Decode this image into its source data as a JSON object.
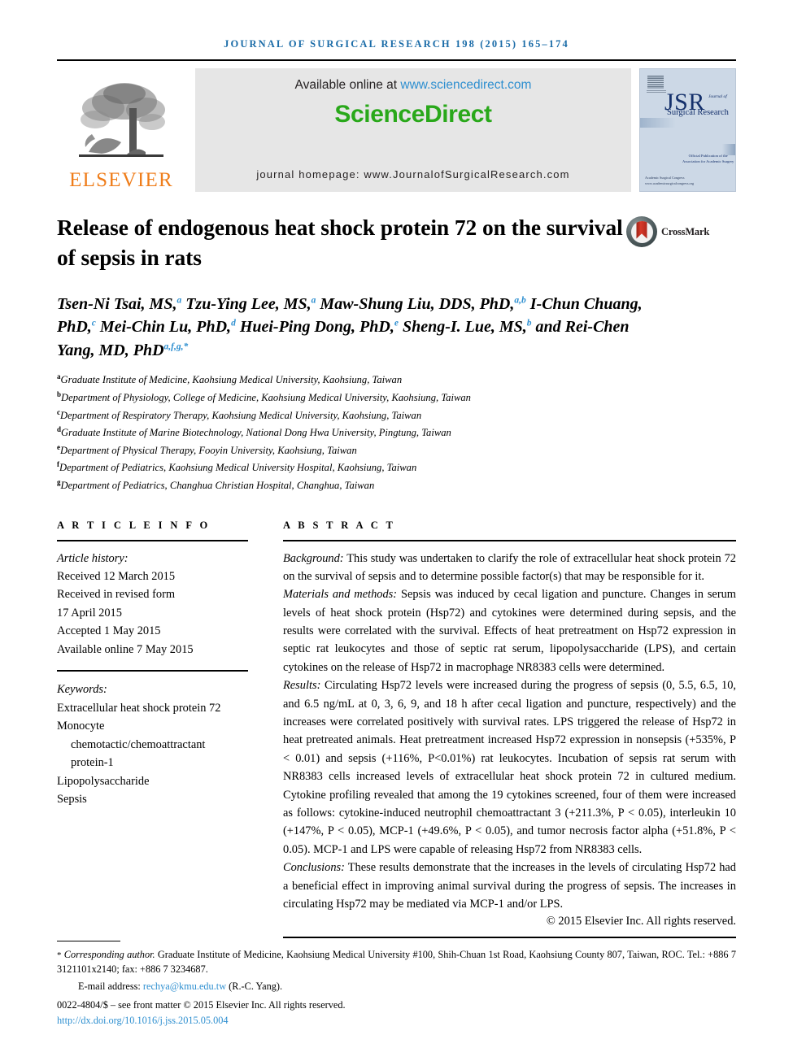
{
  "running_head": "JOURNAL OF SURGICAL RESEARCH 198 (2015) 165–174",
  "masthead": {
    "publisher_name": "ELSEVIER",
    "available_text": "Available online at",
    "sciencedirect_url": "www.sciencedirect.com",
    "sciencedirect_logo": "ScienceDirect",
    "homepage": "journal homepage: www.JournalofSurgicalResearch.com",
    "cover": {
      "title": "JSR",
      "journal_word": "Journal of",
      "subtitle": "Surgical Research",
      "official": "Official Publication of the\nAssociation for Academic Surgery",
      "footer": "Academic Surgical Congress\nwww.academicsurgicalcongress.org"
    }
  },
  "article": {
    "title": "Release of endogenous heat shock protein 72 on the survival of sepsis in rats",
    "crossmark_label": "CrossMark",
    "authors": [
      {
        "name": "Tsen-Ni Tsai, MS,",
        "marks": "a"
      },
      {
        "name": "Tzu-Ying Lee, MS,",
        "marks": "a"
      },
      {
        "name": "Maw-Shung Liu, DDS, PhD,",
        "marks": "a,b"
      },
      {
        "name": "I-Chun Chuang, PhD,",
        "marks": "c"
      },
      {
        "name": "Mei-Chin Lu, PhD,",
        "marks": "d"
      },
      {
        "name": "Huei-Ping Dong, PhD,",
        "marks": "e"
      },
      {
        "name": "Sheng-I. Lue, MS,",
        "marks": "b"
      },
      {
        "name": "and Rei-Chen Yang, MD, PhD",
        "marks": "a,f,g,*"
      }
    ],
    "affiliations": [
      {
        "mark": "a",
        "text": "Graduate Institute of Medicine, Kaohsiung Medical University, Kaohsiung, Taiwan"
      },
      {
        "mark": "b",
        "text": "Department of Physiology, College of Medicine, Kaohsiung Medical University, Kaohsiung, Taiwan"
      },
      {
        "mark": "c",
        "text": "Department of Respiratory Therapy, Kaohsiung Medical University, Kaohsiung, Taiwan"
      },
      {
        "mark": "d",
        "text": "Graduate Institute of Marine Biotechnology, National Dong Hwa University, Pingtung, Taiwan"
      },
      {
        "mark": "e",
        "text": "Department of Physical Therapy, Fooyin University, Kaohsiung, Taiwan"
      },
      {
        "mark": "f",
        "text": "Department of Pediatrics, Kaohsiung Medical University Hospital, Kaohsiung, Taiwan"
      },
      {
        "mark": "g",
        "text": "Department of Pediatrics, Changhua Christian Hospital, Changhua, Taiwan"
      }
    ]
  },
  "article_info": {
    "heading": "A R T I C L E   I N F O",
    "history_label": "Article history:",
    "received": "Received 12 March 2015",
    "revised_label": "Received in revised form",
    "revised_date": "17 April 2015",
    "accepted": "Accepted 1 May 2015",
    "available": "Available online 7 May 2015",
    "keywords_label": "Keywords:",
    "keywords": [
      "Extracellular heat shock protein 72",
      "Monocyte",
      "chemotactic/chemoattractant",
      "protein-1",
      "Lipopolysaccharide",
      "Sepsis"
    ]
  },
  "abstract": {
    "heading": "A B S T R A C T",
    "background_label": "Background:",
    "background_text": " This study was undertaken to clarify the role of extracellular heat shock protein 72 on the survival of sepsis and to determine possible factor(s) that may be responsible for it.",
    "methods_label": "Materials and methods:",
    "methods_text": " Sepsis was induced by cecal ligation and puncture. Changes in serum levels of heat shock protein (Hsp72) and cytokines were determined during sepsis, and the results were correlated with the survival. Effects of heat pretreatment on Hsp72 expression in septic rat leukocytes and those of septic rat serum, lipopolysaccharide (LPS), and certain cytokines on the release of Hsp72 in macrophage NR8383 cells were determined.",
    "results_label": "Results:",
    "results_text": " Circulating Hsp72 levels were increased during the progress of sepsis (0, 5.5, 6.5, 10, and 6.5 ng/mL at 0, 3, 6, 9, and 18 h after cecal ligation and puncture, respectively) and the increases were correlated positively with survival rates. LPS triggered the release of Hsp72 in heat pretreated animals. Heat pretreatment increased Hsp72 expression in nonsepsis (+535%, P < 0.01) and sepsis (+116%, P<0.01%) rat leukocytes. Incubation of sepsis rat serum with NR8383 cells increased levels of extracellular heat shock protein 72 in cultured medium. Cytokine profiling revealed that among the 19 cytokines screened, four of them were increased as follows: cytokine-induced neutrophil chemoattractant 3 (+211.3%, P < 0.05), interleukin 10 (+147%, P < 0.05), MCP-1 (+49.6%, P < 0.05), and tumor necrosis factor alpha (+51.8%, P < 0.05). MCP-1 and LPS were capable of releasing Hsp72 from NR8383 cells.",
    "conclusions_label": "Conclusions:",
    "conclusions_text": " These results demonstrate that the increases in the levels of circulating Hsp72 had a beneficial effect in improving animal survival during the progress of sepsis. The increases in circulating Hsp72 may be mediated via MCP-1 and/or LPS.",
    "copyright": "© 2015 Elsevier Inc. All rights reserved."
  },
  "footer": {
    "corresponding_label": "Corresponding author.",
    "corresponding_text": " Graduate Institute of Medicine, Kaohsiung Medical University #100, Shih-Chuan 1st Road, Kaohsiung County 807, Taiwan, ROC. Tel.: +886 7 3121101x2140; fax: +886 7 3234687.",
    "email_label": "E-mail address:",
    "email": "rechya@kmu.edu.tw",
    "email_attrib": "(R.-C. Yang).",
    "issn_line": "0022-4804/$ – see front matter © 2015 Elsevier Inc. All rights reserved.",
    "doi": "http://dx.doi.org/10.1016/j.jss.2015.05.004"
  },
  "colors": {
    "link_blue": "#2e8fd0",
    "sciencedirect_green": "#29a81a",
    "elsevier_orange": "#ef7d1a",
    "running_head_blue": "#1b6ca8"
  }
}
